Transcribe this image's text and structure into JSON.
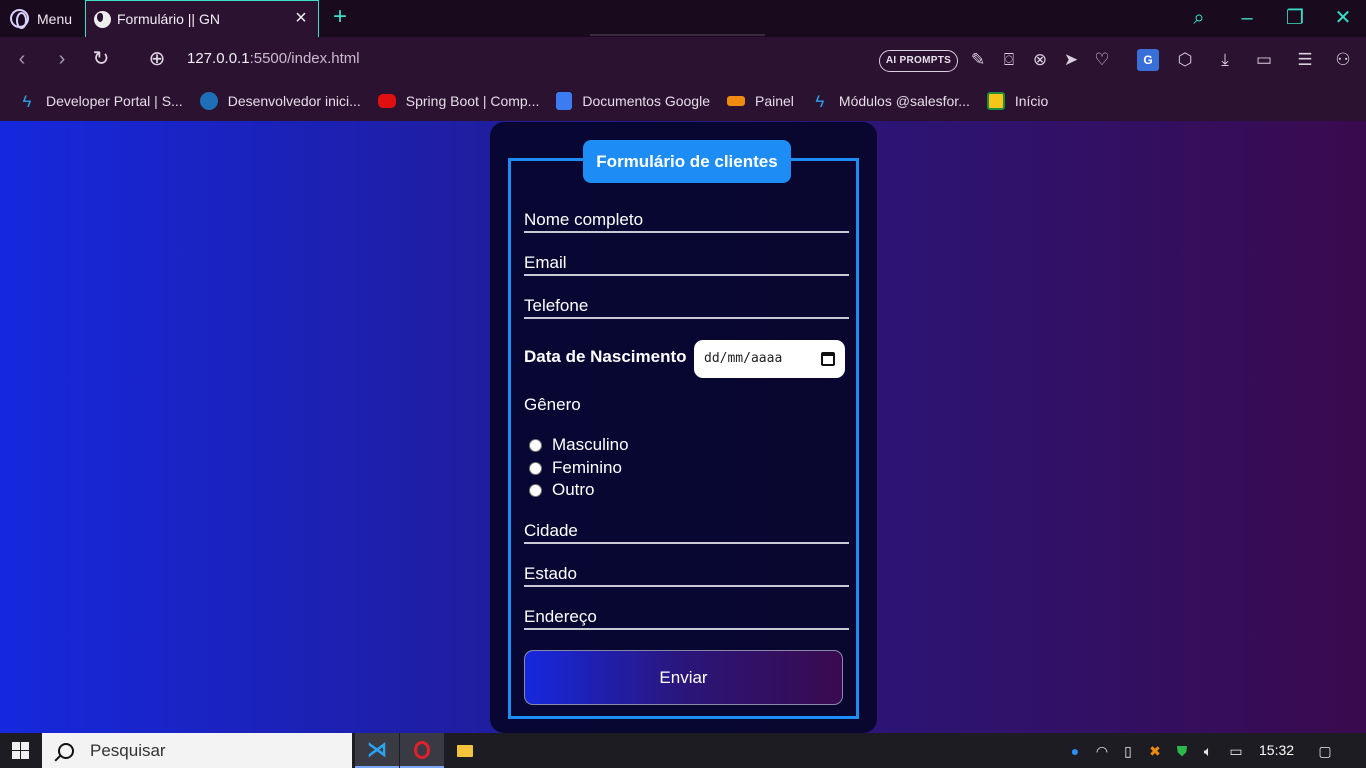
{
  "browser": {
    "menu_label": "Menu",
    "tab_title": "Formulário || GN",
    "url_host": "127.0.0.1",
    "url_rest": ":5500/index.html",
    "ai_prompts_label": "AI PROMPTS",
    "colors": {
      "accent": "#38e0c8",
      "toolbar_bg": "#2b1230"
    }
  },
  "bookmarks": [
    {
      "label": "Developer Portal | S...",
      "icon": "salesforce-bolt-icon"
    },
    {
      "label": "Desenvolvedor inici...",
      "icon": "trailhead-icon"
    },
    {
      "label": "Spring Boot | Comp...",
      "icon": "youtube-icon"
    },
    {
      "label": "Documentos Google",
      "icon": "google-docs-icon"
    },
    {
      "label": "Painel",
      "icon": "moodle-icon"
    },
    {
      "label": "Módulos @salesfor...",
      "icon": "salesforce-bolt-icon"
    },
    {
      "label": "Início",
      "icon": "google-classroom-icon"
    }
  ],
  "form": {
    "legend": "Formulário de clientes",
    "fields": {
      "nome": "Nome completo",
      "email": "Email",
      "telefone": "Telefone",
      "cidade": "Cidade",
      "estado": "Estado",
      "endereco": "Endereço"
    },
    "dob_label": "Data de Nascimento",
    "dob_placeholder": "dd/mm/aaaa",
    "gender_label": "Gênero",
    "gender_options": [
      "Masculino",
      "Feminino",
      "Outro"
    ],
    "submit_label": "Enviar",
    "colors": {
      "border": "#1d8df5",
      "panel_bg": "#05062a"
    }
  },
  "taskbar": {
    "search_placeholder": "Pesquisar",
    "clock": "15:32"
  }
}
